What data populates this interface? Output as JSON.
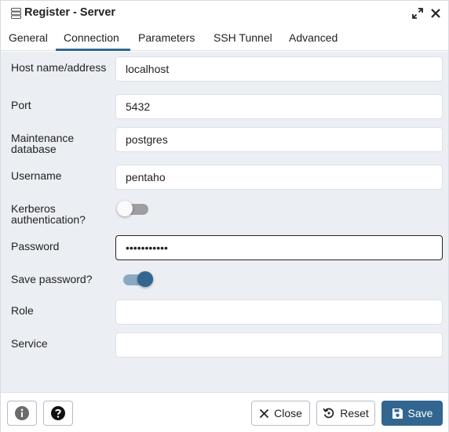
{
  "window": {
    "title": "Register - Server"
  },
  "tabs": [
    {
      "label": "General"
    },
    {
      "label": "Connection"
    },
    {
      "label": "Parameters"
    },
    {
      "label": "SSH Tunnel"
    },
    {
      "label": "Advanced"
    }
  ],
  "active_tab": "Connection",
  "form": {
    "host": {
      "label": "Host name/address",
      "value": "localhost"
    },
    "port": {
      "label": "Port",
      "value": "5432"
    },
    "maintenance_db": {
      "label": "Maintenance database",
      "value": "postgres"
    },
    "username": {
      "label": "Username",
      "value": "pentaho"
    },
    "kerberos": {
      "label": "Kerberos authentication?",
      "enabled": false
    },
    "password": {
      "label": "Password",
      "value": "•••••••••••"
    },
    "save_password": {
      "label": "Save password?",
      "enabled": true
    },
    "role": {
      "label": "Role",
      "value": ""
    },
    "service": {
      "label": "Service",
      "value": ""
    }
  },
  "footer": {
    "close_label": "Close",
    "reset_label": "Reset",
    "save_label": "Save"
  },
  "colors": {
    "accent": "#326690",
    "body_bg": "#ebeef3",
    "toggle_off_track": "#9e9e9e",
    "toggle_on_track": "#8aa9c4"
  },
  "icons": {
    "title": "server-icon",
    "maximize": "expand-icon",
    "close": "close-icon",
    "info": "info-icon",
    "help": "help-icon",
    "close_btn": "x-icon",
    "reset_btn": "reset-icon",
    "save_btn": "save-icon"
  }
}
